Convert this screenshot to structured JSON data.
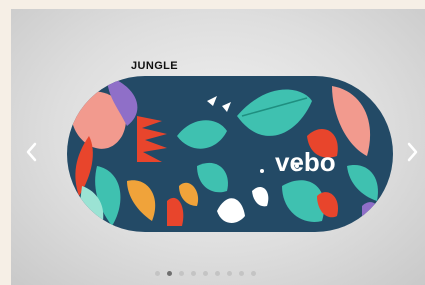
{
  "carousel": {
    "product_label": "JUNGLE",
    "brand_text": "vebo",
    "prev_icon": "chevron-left-icon",
    "next_icon": "chevron-right-icon",
    "slide_count": 9,
    "active_slide": 2,
    "colors": {
      "case_background": "#234a66",
      "accent_teal": "#3fc1b0",
      "accent_red": "#e8452c",
      "accent_pink": "#f29a8e",
      "accent_purple": "#8f6fc8"
    }
  }
}
